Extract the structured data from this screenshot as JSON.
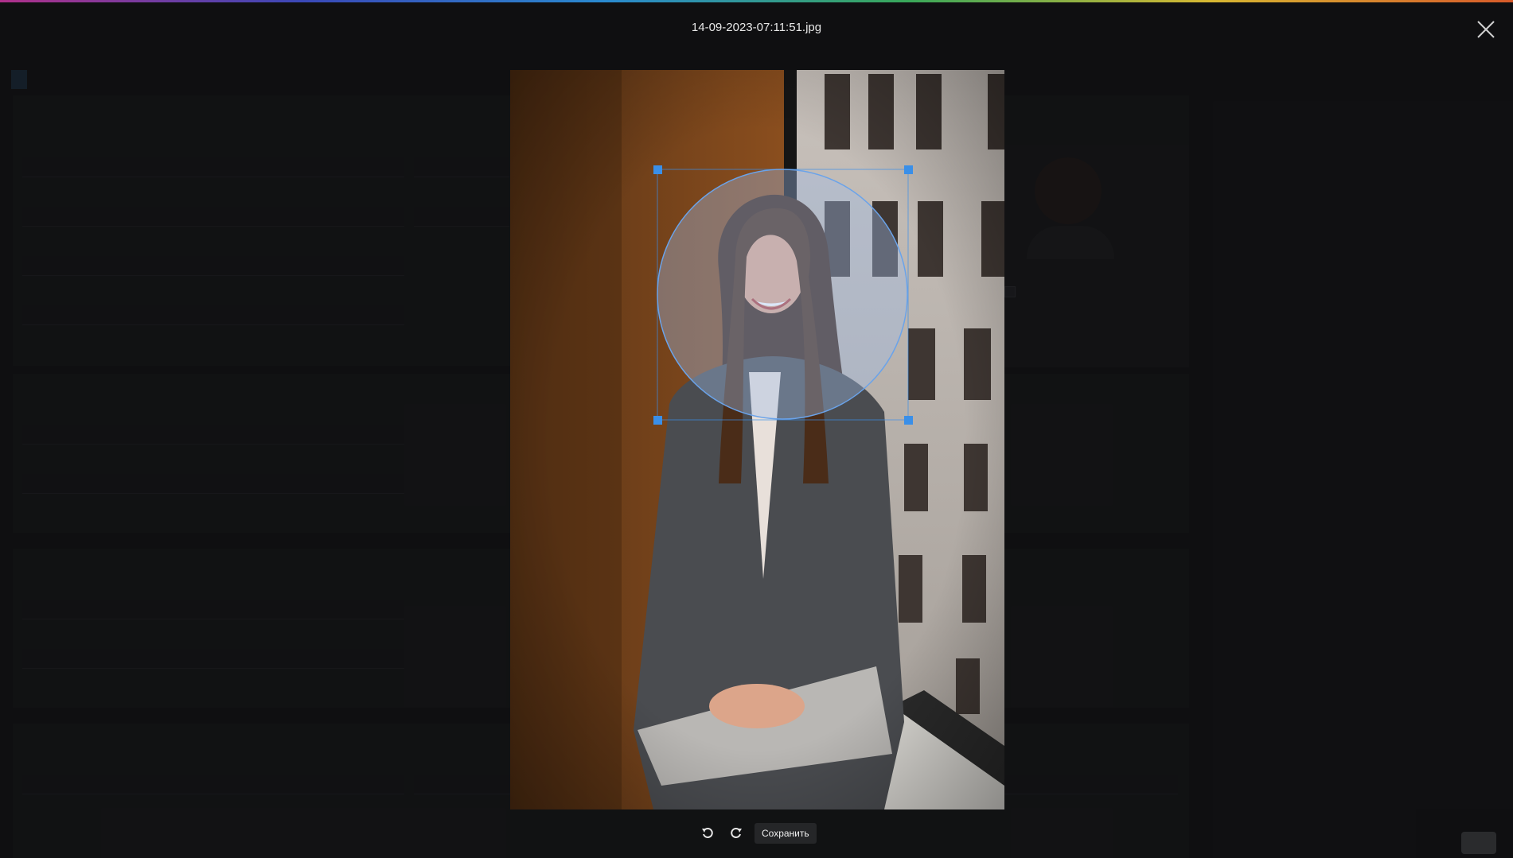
{
  "modal": {
    "filename": "14-09-2023-07:11:51.jpg",
    "save_label": "Сохранить"
  },
  "icons": {
    "close": "close-icon",
    "rotate_left": "rotate-left-icon",
    "rotate_right": "rotate-right-icon"
  },
  "crop": {
    "shape": "circle",
    "accent": "#3a8fe8"
  }
}
